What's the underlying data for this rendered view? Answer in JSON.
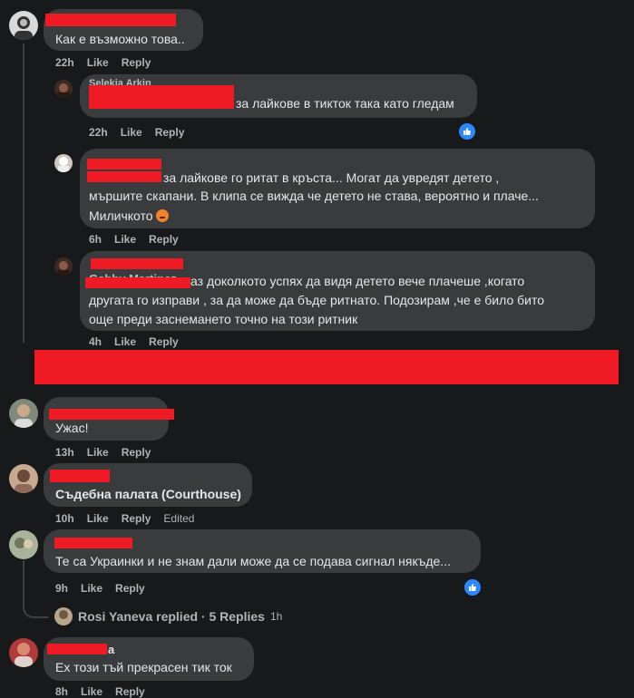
{
  "accent": "#2d88ff",
  "redaction_color": "#ee1b24",
  "comments": [
    {
      "text": "Как е възможно това..",
      "time": "22h",
      "like": "Like",
      "reply": "Reply"
    },
    {
      "name_partial": "Selekia Arkin",
      "text": "за лайкове в тикток така като гледам",
      "time": "22h",
      "like": "Like",
      "reply": "Reply"
    },
    {
      "text_line1": "за лайкове го ритат в кръста... Могат да увредят детето ,",
      "text_line2": "мършите скапани. В клипа се вижда че детето не става, вероятно и плаче...",
      "text_line3": "Миличкото",
      "time": "6h",
      "like": "Like",
      "reply": "Reply"
    },
    {
      "name_partial": "Gabby Martinez",
      "text_line1": "аз доколкото успях да видя детето вече плачеше ,когато",
      "text_line2": "другата го изправи , за да може да бъде ритнато. Подозирам ,че е било бито",
      "text_line3": "още преди заснемането точно на този ритник",
      "time": "4h",
      "like": "Like",
      "reply": "Reply"
    },
    {
      "text": "Ужас!",
      "time": "13h",
      "like": "Like",
      "reply": "Reply"
    },
    {
      "text": "Съдебна палата (Courthouse)",
      "time": "10h",
      "like": "Like",
      "reply": "Reply",
      "edited": "Edited"
    },
    {
      "text": "Те са Украинки и не знам дали може да се подава сигнал някъде...",
      "time": "9h",
      "like": "Like",
      "reply": "Reply"
    },
    {
      "text": "Ех този тъй прекрасен тик ток",
      "time": "8h",
      "like": "Like",
      "reply": "Reply",
      "name_suffix": "a"
    }
  ],
  "replies_summary": {
    "text": "Rosi Yaneva replied · 5 Replies",
    "time": "1h"
  }
}
